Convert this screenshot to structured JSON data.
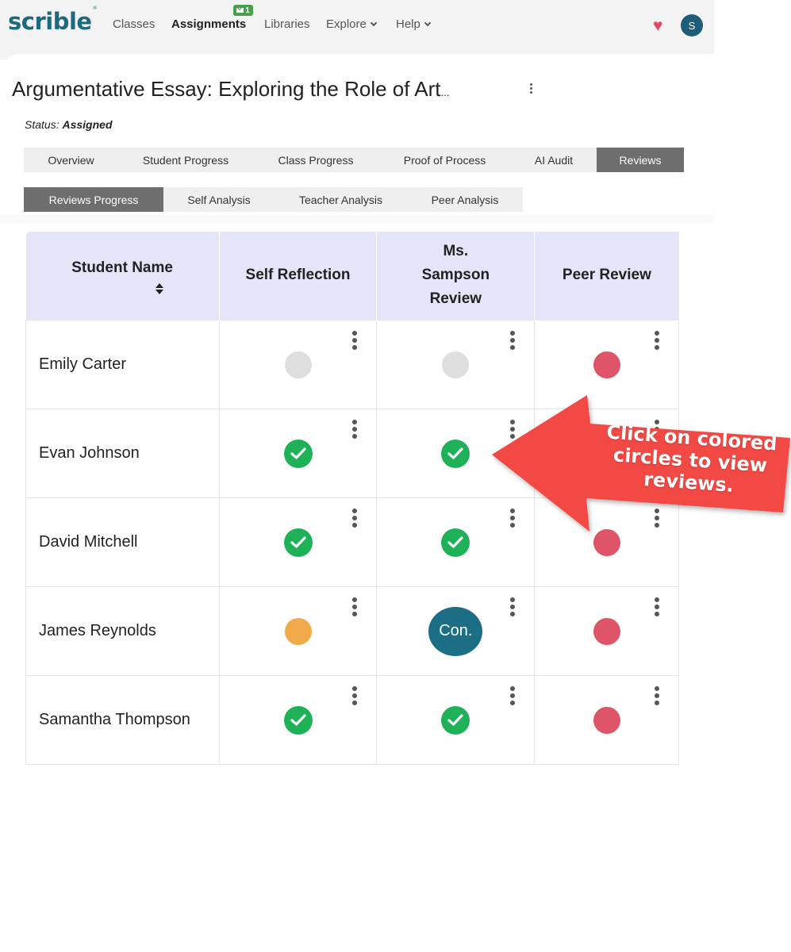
{
  "nav": {
    "logo": "scrible",
    "logo_mark": "®",
    "items": [
      {
        "label": "Classes"
      },
      {
        "label": "Assignments",
        "badge": "1"
      },
      {
        "label": "Libraries"
      },
      {
        "label": "Explore"
      },
      {
        "label": "Help"
      }
    ],
    "avatar": "S"
  },
  "header": {
    "title": "Argumentative Essay: Exploring the Role of Art",
    "title_ellipsis": "...",
    "status_label": "Status:",
    "status_value": "Assigned"
  },
  "tabs": [
    {
      "label": "Overview"
    },
    {
      "label": "Student Progress"
    },
    {
      "label": "Class Progress"
    },
    {
      "label": "Proof of Process"
    },
    {
      "label": "AI Audit"
    },
    {
      "label": "Reviews",
      "active": true
    }
  ],
  "subtabs": [
    {
      "label": "Reviews Progress",
      "active": true
    },
    {
      "label": "Self Analysis"
    },
    {
      "label": "Teacher Analysis"
    },
    {
      "label": "Peer Analysis"
    }
  ],
  "table": {
    "columns": [
      {
        "label": "Student Name"
      },
      {
        "label": "Self Reflection"
      },
      {
        "label": "Ms. Sampson Review"
      },
      {
        "label": "Peer Review"
      }
    ],
    "rows": [
      {
        "name": "Emily Carter",
        "self": "not-started",
        "teacher": "not-started",
        "peer": "pending"
      },
      {
        "name": "Evan Johnson",
        "self": "complete",
        "teacher": "complete",
        "peer": "pending"
      },
      {
        "name": "David Mitchell",
        "self": "complete",
        "teacher": "complete",
        "peer": "pending"
      },
      {
        "name": "James Reynolds",
        "self": "in-progress",
        "teacher": "con",
        "peer": "pending"
      },
      {
        "name": "Samantha Thompson",
        "self": "complete",
        "teacher": "complete",
        "peer": "pending"
      }
    ],
    "con_label": "Con."
  },
  "callout": {
    "text": "Click on colored circles to view reviews."
  },
  "colors": {
    "brand": "#1d6a80",
    "accent_red": "#e05468",
    "complete_green": "#1fb157",
    "in_progress_orange": "#f0aa4a",
    "not_started_grey": "#dedede",
    "callout_red": "#f24a45"
  }
}
